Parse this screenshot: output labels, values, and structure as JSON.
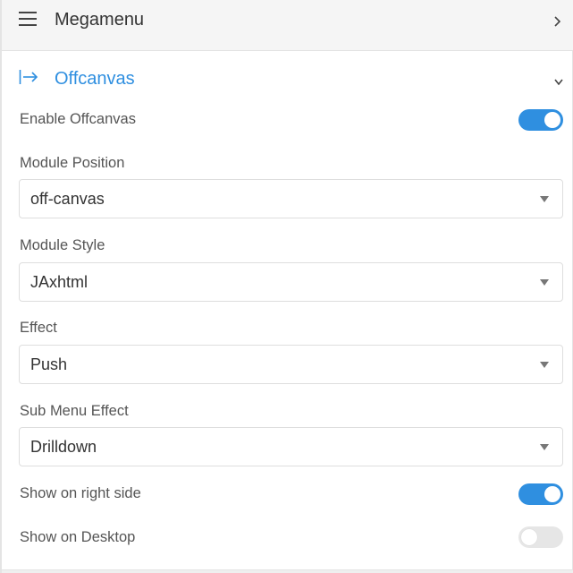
{
  "header": {
    "icon": "hamburger-menu-icon",
    "title": "Megamenu",
    "chevron_icon": "chevron-right-icon"
  },
  "section": {
    "icon": "arrow-right-to-bar-icon",
    "title": "Offcanvas",
    "chevron_icon": "chevron-down-icon",
    "accent_color": "#2f8fe0"
  },
  "fields": {
    "enable_offcanvas": {
      "label": "Enable Offcanvas",
      "enabled": true
    },
    "module_position": {
      "label": "Module Position",
      "value": "off-canvas"
    },
    "module_style": {
      "label": "Module Style",
      "value": "JAxhtml"
    },
    "effect": {
      "label": "Effect",
      "value": "Push"
    },
    "sub_menu_effect": {
      "label": "Sub Menu Effect",
      "value": "Drilldown"
    },
    "show_on_right_side": {
      "label": "Show on right side",
      "enabled": true
    },
    "show_on_desktop": {
      "label": "Show on Desktop",
      "enabled": false
    }
  }
}
